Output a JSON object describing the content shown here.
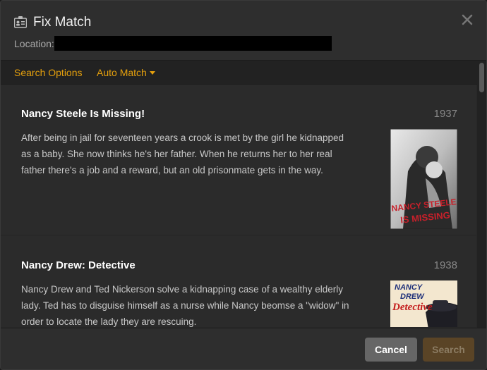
{
  "dialog": {
    "title": "Fix Match",
    "title_icon": "id-card-icon",
    "close_icon": "close-icon",
    "location_label": "Location:",
    "location_value": ""
  },
  "toolbar": {
    "search_options_label": "Search Options",
    "auto_match_label": "Auto Match"
  },
  "results": [
    {
      "title": "Nancy Steele Is Missing!",
      "year": "1937",
      "summary": "After being in jail for seventeen years a crook is met by the girl he kidnapped as a baby. She now thinks he's her father. When he returns her to her real father there's a job and a reward, but an old prisonmate gets in the way.",
      "poster_text_line1": "NANCY STEELE",
      "poster_text_line2": "IS MISSING"
    },
    {
      "title": "Nancy Drew: Detective",
      "year": "1938",
      "summary": "Nancy Drew and Ted Nickerson solve a kidnapping case of a wealthy elderly lady. Ted has to disguise himself as a nurse while Nancy beomse a \"widow\" in order to locate the lady they are rescuing.",
      "poster_text_line1": "NANCY",
      "poster_text_line2": "DREW",
      "poster_text_line3": "Detective"
    }
  ],
  "footer": {
    "cancel_label": "Cancel",
    "search_label": "Search"
  },
  "colors": {
    "accent": "#e5a00d",
    "background": "#282828",
    "cancel_button": "#666666",
    "search_button_disabled": "#5a4426"
  }
}
